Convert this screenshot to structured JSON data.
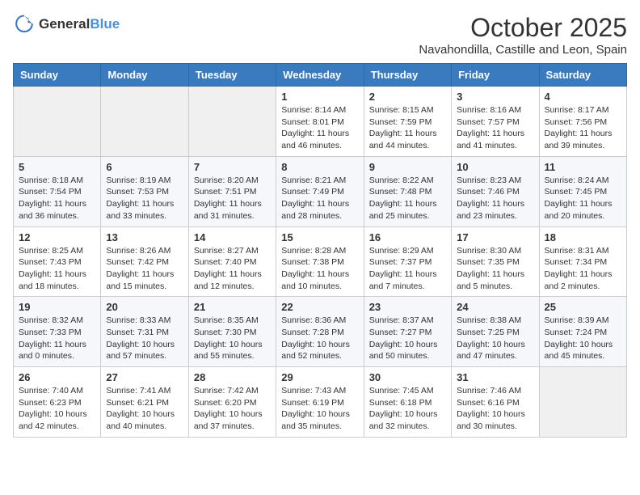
{
  "logo": {
    "general": "General",
    "blue": "Blue"
  },
  "header": {
    "month": "October 2025",
    "location": "Navahondilla, Castille and Leon, Spain"
  },
  "weekdays": [
    "Sunday",
    "Monday",
    "Tuesday",
    "Wednesday",
    "Thursday",
    "Friday",
    "Saturday"
  ],
  "weeks": [
    [
      {
        "day": "",
        "info": ""
      },
      {
        "day": "",
        "info": ""
      },
      {
        "day": "",
        "info": ""
      },
      {
        "day": "1",
        "info": "Sunrise: 8:14 AM\nSunset: 8:01 PM\nDaylight: 11 hours and 46 minutes."
      },
      {
        "day": "2",
        "info": "Sunrise: 8:15 AM\nSunset: 7:59 PM\nDaylight: 11 hours and 44 minutes."
      },
      {
        "day": "3",
        "info": "Sunrise: 8:16 AM\nSunset: 7:57 PM\nDaylight: 11 hours and 41 minutes."
      },
      {
        "day": "4",
        "info": "Sunrise: 8:17 AM\nSunset: 7:56 PM\nDaylight: 11 hours and 39 minutes."
      }
    ],
    [
      {
        "day": "5",
        "info": "Sunrise: 8:18 AM\nSunset: 7:54 PM\nDaylight: 11 hours and 36 minutes."
      },
      {
        "day": "6",
        "info": "Sunrise: 8:19 AM\nSunset: 7:53 PM\nDaylight: 11 hours and 33 minutes."
      },
      {
        "day": "7",
        "info": "Sunrise: 8:20 AM\nSunset: 7:51 PM\nDaylight: 11 hours and 31 minutes."
      },
      {
        "day": "8",
        "info": "Sunrise: 8:21 AM\nSunset: 7:49 PM\nDaylight: 11 hours and 28 minutes."
      },
      {
        "day": "9",
        "info": "Sunrise: 8:22 AM\nSunset: 7:48 PM\nDaylight: 11 hours and 25 minutes."
      },
      {
        "day": "10",
        "info": "Sunrise: 8:23 AM\nSunset: 7:46 PM\nDaylight: 11 hours and 23 minutes."
      },
      {
        "day": "11",
        "info": "Sunrise: 8:24 AM\nSunset: 7:45 PM\nDaylight: 11 hours and 20 minutes."
      }
    ],
    [
      {
        "day": "12",
        "info": "Sunrise: 8:25 AM\nSunset: 7:43 PM\nDaylight: 11 hours and 18 minutes."
      },
      {
        "day": "13",
        "info": "Sunrise: 8:26 AM\nSunset: 7:42 PM\nDaylight: 11 hours and 15 minutes."
      },
      {
        "day": "14",
        "info": "Sunrise: 8:27 AM\nSunset: 7:40 PM\nDaylight: 11 hours and 12 minutes."
      },
      {
        "day": "15",
        "info": "Sunrise: 8:28 AM\nSunset: 7:38 PM\nDaylight: 11 hours and 10 minutes."
      },
      {
        "day": "16",
        "info": "Sunrise: 8:29 AM\nSunset: 7:37 PM\nDaylight: 11 hours and 7 minutes."
      },
      {
        "day": "17",
        "info": "Sunrise: 8:30 AM\nSunset: 7:35 PM\nDaylight: 11 hours and 5 minutes."
      },
      {
        "day": "18",
        "info": "Sunrise: 8:31 AM\nSunset: 7:34 PM\nDaylight: 11 hours and 2 minutes."
      }
    ],
    [
      {
        "day": "19",
        "info": "Sunrise: 8:32 AM\nSunset: 7:33 PM\nDaylight: 11 hours and 0 minutes."
      },
      {
        "day": "20",
        "info": "Sunrise: 8:33 AM\nSunset: 7:31 PM\nDaylight: 10 hours and 57 minutes."
      },
      {
        "day": "21",
        "info": "Sunrise: 8:35 AM\nSunset: 7:30 PM\nDaylight: 10 hours and 55 minutes."
      },
      {
        "day": "22",
        "info": "Sunrise: 8:36 AM\nSunset: 7:28 PM\nDaylight: 10 hours and 52 minutes."
      },
      {
        "day": "23",
        "info": "Sunrise: 8:37 AM\nSunset: 7:27 PM\nDaylight: 10 hours and 50 minutes."
      },
      {
        "day": "24",
        "info": "Sunrise: 8:38 AM\nSunset: 7:25 PM\nDaylight: 10 hours and 47 minutes."
      },
      {
        "day": "25",
        "info": "Sunrise: 8:39 AM\nSunset: 7:24 PM\nDaylight: 10 hours and 45 minutes."
      }
    ],
    [
      {
        "day": "26",
        "info": "Sunrise: 7:40 AM\nSunset: 6:23 PM\nDaylight: 10 hours and 42 minutes."
      },
      {
        "day": "27",
        "info": "Sunrise: 7:41 AM\nSunset: 6:21 PM\nDaylight: 10 hours and 40 minutes."
      },
      {
        "day": "28",
        "info": "Sunrise: 7:42 AM\nSunset: 6:20 PM\nDaylight: 10 hours and 37 minutes."
      },
      {
        "day": "29",
        "info": "Sunrise: 7:43 AM\nSunset: 6:19 PM\nDaylight: 10 hours and 35 minutes."
      },
      {
        "day": "30",
        "info": "Sunrise: 7:45 AM\nSunset: 6:18 PM\nDaylight: 10 hours and 32 minutes."
      },
      {
        "day": "31",
        "info": "Sunrise: 7:46 AM\nSunset: 6:16 PM\nDaylight: 10 hours and 30 minutes."
      },
      {
        "day": "",
        "info": ""
      }
    ]
  ]
}
